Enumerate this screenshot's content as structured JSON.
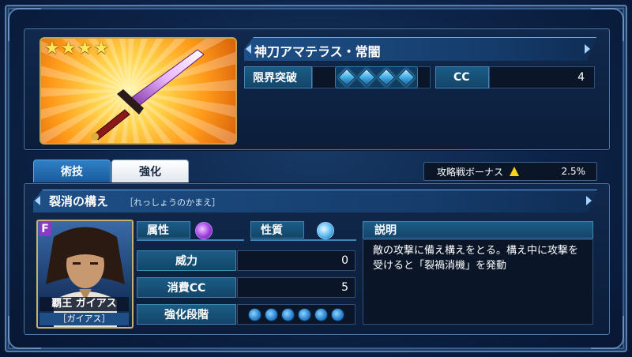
{
  "weapon": {
    "name": "神刀アマテラス・常闇",
    "rarity_stars": 4,
    "limit_break_label": "限界突破",
    "limit_break_gems": 4,
    "cc_label": "CC",
    "cc_value": "4"
  },
  "tabs": {
    "skill": "術技",
    "enhance": "強化"
  },
  "bonus": {
    "label": "攻略戦ボーナス",
    "value": "2.5%"
  },
  "skill": {
    "name": "裂消の構え",
    "reading": "［れっしょうのかまえ］",
    "attribute_label": "属性",
    "nature_label": "性質",
    "stats": [
      {
        "label": "威力",
        "value": "0"
      },
      {
        "label": "消費CC",
        "value": "5"
      },
      {
        "label": "強化段階",
        "value": ""
      }
    ],
    "enhance_level_circles": 6,
    "description_label": "説明",
    "description": "敵の攻撃に備え構えをとる。構え中に攻撃を受けると「裂禍消機」を発動"
  },
  "character": {
    "badge": "F",
    "name": "覇王 ガイアス",
    "sub": "［ガイアス］"
  },
  "colors": {
    "accent": "#1d4f86",
    "gold": "#ffe65a"
  }
}
